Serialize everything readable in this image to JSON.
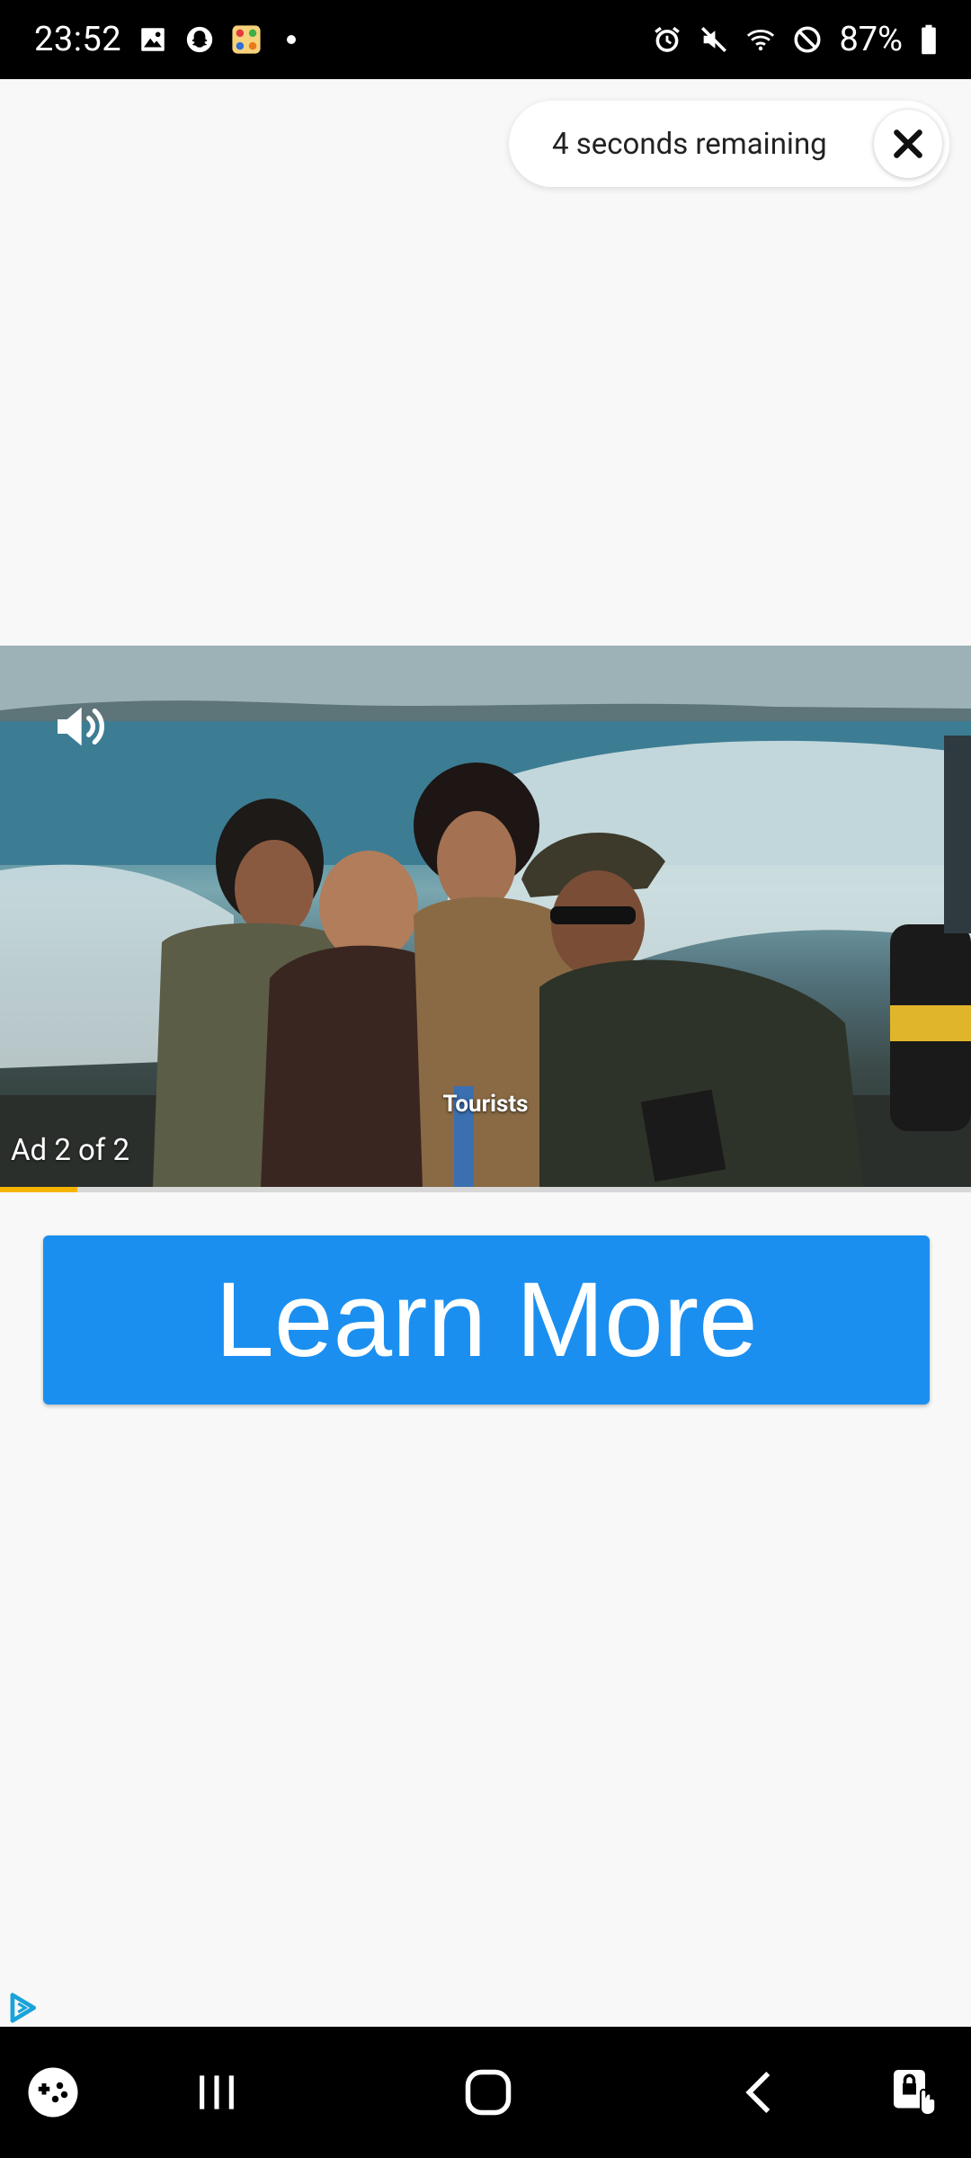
{
  "status_bar": {
    "time": "23:52",
    "battery": "87%",
    "left_icons": [
      "gallery-icon",
      "snapchat-icon",
      "game-app-icon",
      "notification-dot"
    ],
    "right_icons": [
      "alarm-icon",
      "mute-icon",
      "wifi-icon",
      "do-not-disturb-icon",
      "battery-icon"
    ]
  },
  "ad": {
    "countdown": "4 seconds remaining",
    "caption": "Tourists",
    "counter": "Ad 2 of 2",
    "progress": 0.08,
    "cta_label": "Learn More"
  },
  "nav_bar": {
    "items": [
      "game-launcher-icon",
      "recents-icon",
      "home-icon",
      "back-icon",
      "screen-lock-touch-icon"
    ]
  },
  "colors": {
    "cta": "#1a8ff0",
    "progress": "#f4b400"
  }
}
